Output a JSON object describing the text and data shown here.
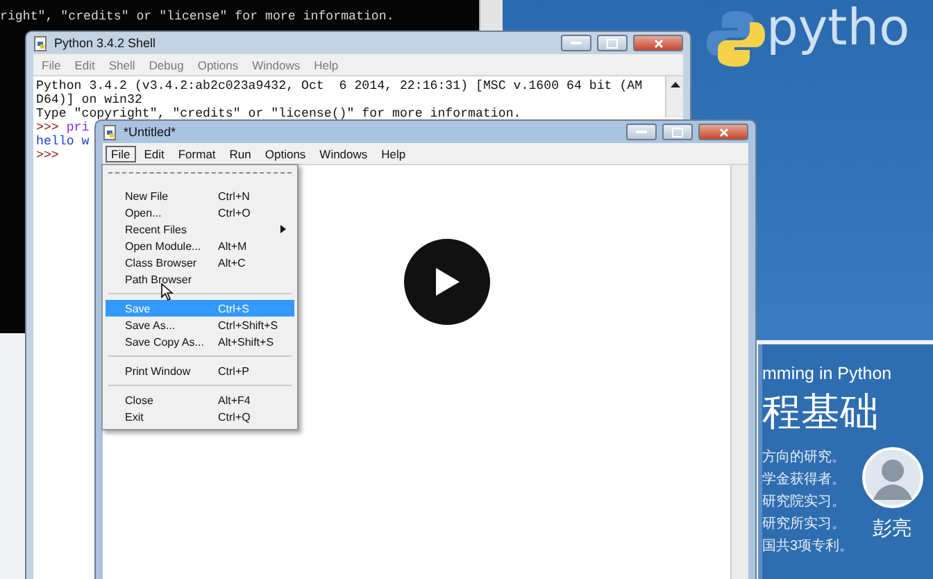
{
  "console": {
    "lines": [
      "right\", \"credits\" or \"license\" for more information."
    ]
  },
  "slide": {
    "logo_text": "pytho",
    "subtitle": "mming in Python",
    "title": "程基础",
    "lines": [
      "方向的研究。",
      "学金获得者。",
      "研究院实习。",
      "研究所实习。",
      "国共3项专利。"
    ],
    "author": "彭亮"
  },
  "shell_window": {
    "title": "Python 3.4.2 Shell",
    "menu": [
      "File",
      "Edit",
      "Shell",
      "Debug",
      "Options",
      "Windows",
      "Help"
    ],
    "lines": [
      {
        "kind": "banner",
        "text": "Python 3.4.2 (v3.4.2:ab2c023a9432, Oct  6 2014, 22:16:31) [MSC v.1600 64 bit (AM"
      },
      {
        "kind": "banner",
        "text": "D64)] on win32"
      },
      {
        "kind": "banner",
        "text": "Type \"copyright\", \"credits\" or \"license()\" for more information."
      },
      {
        "kind": "input",
        "prompt": ">>>",
        "code": "pri"
      },
      {
        "kind": "output",
        "text": "hello w"
      },
      {
        "kind": "input",
        "prompt": ">>>"
      }
    ]
  },
  "editor_window": {
    "title": "*Untitled*",
    "menu": [
      {
        "label": "File",
        "selected": true
      },
      {
        "label": "Edit",
        "selected": false
      },
      {
        "label": "Format",
        "selected": false
      },
      {
        "label": "Run",
        "selected": false
      },
      {
        "label": "Options",
        "selected": false
      },
      {
        "label": "Windows",
        "selected": false
      },
      {
        "label": "Help",
        "selected": false
      }
    ]
  },
  "file_menu": {
    "items": [
      {
        "kind": "tearoff"
      },
      {
        "kind": "item",
        "label": "New File",
        "shortcut": "Ctrl+N",
        "submenu": false,
        "selected": false
      },
      {
        "kind": "item",
        "label": "Open...",
        "shortcut": "Ctrl+O",
        "submenu": false,
        "selected": false
      },
      {
        "kind": "item",
        "label": "Recent Files",
        "submenu": true,
        "selected": false
      },
      {
        "kind": "item",
        "label": "Open Module...",
        "shortcut": "Alt+M",
        "submenu": false,
        "selected": false
      },
      {
        "kind": "item",
        "label": "Class Browser",
        "shortcut": "Alt+C",
        "submenu": false,
        "selected": false
      },
      {
        "kind": "item",
        "label": "Path Browser",
        "submenu": false,
        "selected": false
      },
      {
        "kind": "separator"
      },
      {
        "kind": "item",
        "label": "Save",
        "shortcut": "Ctrl+S",
        "submenu": false,
        "selected": true
      },
      {
        "kind": "item",
        "label": "Save As...",
        "shortcut": "Ctrl+Shift+S",
        "submenu": false,
        "selected": false
      },
      {
        "kind": "item",
        "label": "Save Copy As...",
        "shortcut": "Alt+Shift+S",
        "submenu": false,
        "selected": false
      },
      {
        "kind": "separator"
      },
      {
        "kind": "item",
        "label": "Print Window",
        "shortcut": "Ctrl+P",
        "submenu": false,
        "selected": false
      },
      {
        "kind": "separator"
      },
      {
        "kind": "item",
        "label": "Close",
        "shortcut": "Alt+F4",
        "submenu": false,
        "selected": false
      },
      {
        "kind": "item",
        "label": "Exit",
        "shortcut": "Ctrl+Q",
        "submenu": false,
        "selected": false
      }
    ]
  },
  "player": {
    "paused": true
  }
}
